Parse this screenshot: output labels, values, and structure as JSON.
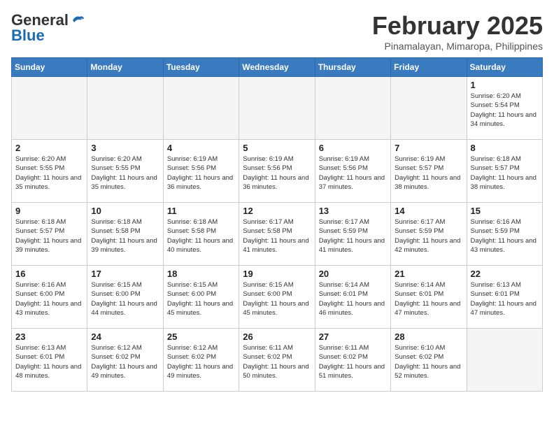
{
  "header": {
    "logo_general": "General",
    "logo_blue": "Blue",
    "month_title": "February 2025",
    "location": "Pinamalayan, Mimaropa, Philippines"
  },
  "days_of_week": [
    "Sunday",
    "Monday",
    "Tuesday",
    "Wednesday",
    "Thursday",
    "Friday",
    "Saturday"
  ],
  "weeks": [
    [
      {
        "day": "",
        "empty": true
      },
      {
        "day": "",
        "empty": true
      },
      {
        "day": "",
        "empty": true
      },
      {
        "day": "",
        "empty": true
      },
      {
        "day": "",
        "empty": true
      },
      {
        "day": "",
        "empty": true
      },
      {
        "day": "1",
        "sunrise": "6:20 AM",
        "sunset": "5:54 PM",
        "daylight": "11 hours and 34 minutes."
      }
    ],
    [
      {
        "day": "2",
        "sunrise": "6:20 AM",
        "sunset": "5:55 PM",
        "daylight": "11 hours and 35 minutes."
      },
      {
        "day": "3",
        "sunrise": "6:20 AM",
        "sunset": "5:55 PM",
        "daylight": "11 hours and 35 minutes."
      },
      {
        "day": "4",
        "sunrise": "6:19 AM",
        "sunset": "5:56 PM",
        "daylight": "11 hours and 36 minutes."
      },
      {
        "day": "5",
        "sunrise": "6:19 AM",
        "sunset": "5:56 PM",
        "daylight": "11 hours and 36 minutes."
      },
      {
        "day": "6",
        "sunrise": "6:19 AM",
        "sunset": "5:56 PM",
        "daylight": "11 hours and 37 minutes."
      },
      {
        "day": "7",
        "sunrise": "6:19 AM",
        "sunset": "5:57 PM",
        "daylight": "11 hours and 38 minutes."
      },
      {
        "day": "8",
        "sunrise": "6:18 AM",
        "sunset": "5:57 PM",
        "daylight": "11 hours and 38 minutes."
      }
    ],
    [
      {
        "day": "9",
        "sunrise": "6:18 AM",
        "sunset": "5:57 PM",
        "daylight": "11 hours and 39 minutes."
      },
      {
        "day": "10",
        "sunrise": "6:18 AM",
        "sunset": "5:58 PM",
        "daylight": "11 hours and 39 minutes."
      },
      {
        "day": "11",
        "sunrise": "6:18 AM",
        "sunset": "5:58 PM",
        "daylight": "11 hours and 40 minutes."
      },
      {
        "day": "12",
        "sunrise": "6:17 AM",
        "sunset": "5:58 PM",
        "daylight": "11 hours and 41 minutes."
      },
      {
        "day": "13",
        "sunrise": "6:17 AM",
        "sunset": "5:59 PM",
        "daylight": "11 hours and 41 minutes."
      },
      {
        "day": "14",
        "sunrise": "6:17 AM",
        "sunset": "5:59 PM",
        "daylight": "11 hours and 42 minutes."
      },
      {
        "day": "15",
        "sunrise": "6:16 AM",
        "sunset": "5:59 PM",
        "daylight": "11 hours and 43 minutes."
      }
    ],
    [
      {
        "day": "16",
        "sunrise": "6:16 AM",
        "sunset": "6:00 PM",
        "daylight": "11 hours and 43 minutes."
      },
      {
        "day": "17",
        "sunrise": "6:15 AM",
        "sunset": "6:00 PM",
        "daylight": "11 hours and 44 minutes."
      },
      {
        "day": "18",
        "sunrise": "6:15 AM",
        "sunset": "6:00 PM",
        "daylight": "11 hours and 45 minutes."
      },
      {
        "day": "19",
        "sunrise": "6:15 AM",
        "sunset": "6:00 PM",
        "daylight": "11 hours and 45 minutes."
      },
      {
        "day": "20",
        "sunrise": "6:14 AM",
        "sunset": "6:01 PM",
        "daylight": "11 hours and 46 minutes."
      },
      {
        "day": "21",
        "sunrise": "6:14 AM",
        "sunset": "6:01 PM",
        "daylight": "11 hours and 47 minutes."
      },
      {
        "day": "22",
        "sunrise": "6:13 AM",
        "sunset": "6:01 PM",
        "daylight": "11 hours and 47 minutes."
      }
    ],
    [
      {
        "day": "23",
        "sunrise": "6:13 AM",
        "sunset": "6:01 PM",
        "daylight": "11 hours and 48 minutes."
      },
      {
        "day": "24",
        "sunrise": "6:12 AM",
        "sunset": "6:02 PM",
        "daylight": "11 hours and 49 minutes."
      },
      {
        "day": "25",
        "sunrise": "6:12 AM",
        "sunset": "6:02 PM",
        "daylight": "11 hours and 49 minutes."
      },
      {
        "day": "26",
        "sunrise": "6:11 AM",
        "sunset": "6:02 PM",
        "daylight": "11 hours and 50 minutes."
      },
      {
        "day": "27",
        "sunrise": "6:11 AM",
        "sunset": "6:02 PM",
        "daylight": "11 hours and 51 minutes."
      },
      {
        "day": "28",
        "sunrise": "6:10 AM",
        "sunset": "6:02 PM",
        "daylight": "11 hours and 52 minutes."
      },
      {
        "day": "",
        "empty": true
      }
    ]
  ]
}
